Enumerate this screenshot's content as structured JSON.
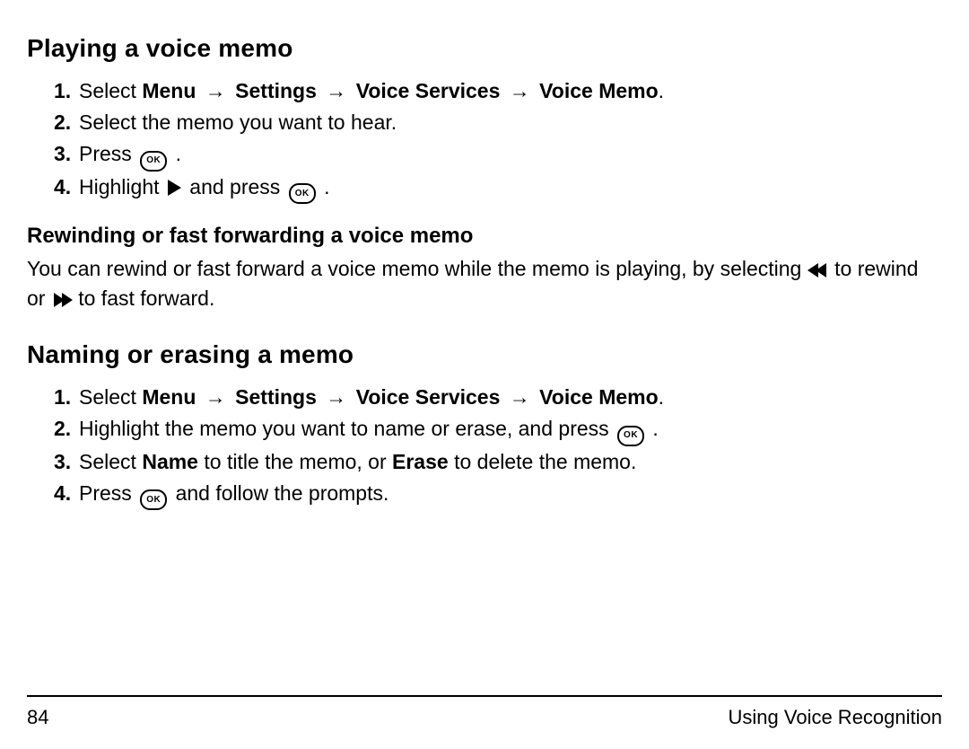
{
  "section1": {
    "title": "Playing a voice memo",
    "steps": {
      "s1_prefix": "Select ",
      "path": [
        "Menu",
        "Settings",
        "Voice Services",
        "Voice Memo"
      ],
      "s2": "Select the memo you want to hear.",
      "s3": "Press ",
      "s4a": "Highlight ",
      "s4b": " and press "
    },
    "sub_title": "Rewinding or fast forwarding a voice memo",
    "sub_text_a": "You can rewind or fast forward a voice memo while the memo is playing, by selecting ",
    "sub_text_b": " to rewind or ",
    "sub_text_c": " to fast forward."
  },
  "section2": {
    "title": "Naming or erasing a memo",
    "steps": {
      "s1_prefix": "Select ",
      "path": [
        "Menu",
        "Settings",
        "Voice Services",
        "Voice Memo"
      ],
      "s2a": "Highlight the memo you want to name or erase, and press ",
      "s3a": "Select ",
      "s3b": "Name",
      "s3c": " to title the memo, or ",
      "s3d": "Erase",
      "s3e": " to delete the memo.",
      "s4a": "Press ",
      "s4b": " and follow the prompts."
    }
  },
  "arrow": "→",
  "ok_label": "OK",
  "footer": {
    "page": "84",
    "chapter": "Using Voice Recognition"
  }
}
